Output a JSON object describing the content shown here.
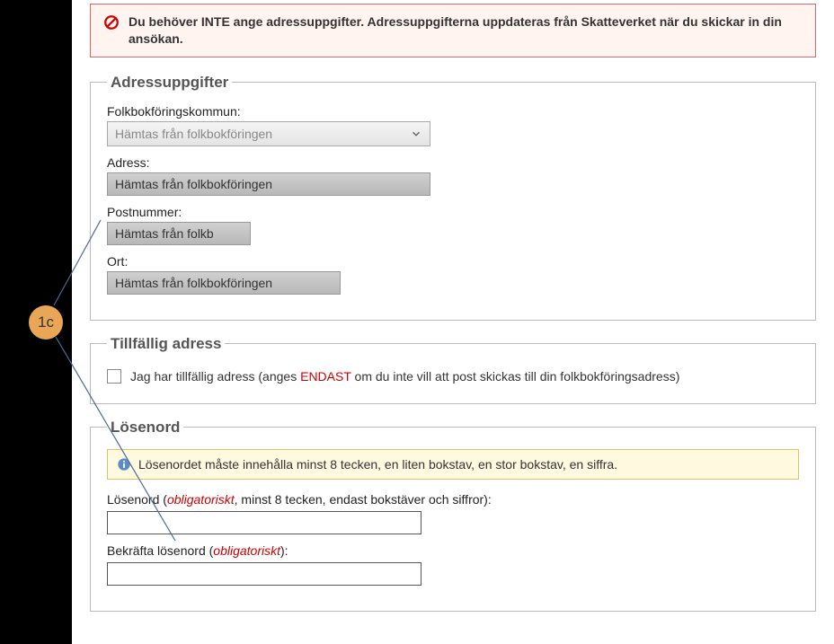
{
  "annotation": {
    "label": "1c"
  },
  "alert": {
    "text": "Du behöver INTE ange adressuppgifter. Adressuppgifterna uppdateras från Skatteverket när du skickar in din ansökan."
  },
  "address": {
    "legend": "Adressuppgifter",
    "kommun": {
      "label": "Folkbokföringskommun:",
      "value": "Hämtas från folkbokföringen"
    },
    "adress": {
      "label": "Adress:",
      "value": "Hämtas från folkbokföringen"
    },
    "postnummer": {
      "label": "Postnummer:",
      "value": "Hämtas från folkb"
    },
    "ort": {
      "label": "Ort:",
      "value": "Hämtas från folkbokföringen"
    }
  },
  "temp": {
    "legend": "Tillfällig adress",
    "check_pre": "Jag har tillfällig adress (anges ",
    "check_mid": "ENDAST",
    "check_post": " om du inte vill att post skickas till din folkbokföringsadress)"
  },
  "password": {
    "legend": "Lösenord",
    "info": "Lösenordet måste innehålla minst 8 tecken, en liten bokstav, en stor bokstav, en siffra.",
    "pw_pre": "Lösenord (",
    "pw_obl": "obligatoriskt",
    "pw_post": ", minst 8 tecken, endast bokstäver och siffror):",
    "conf_pre": "Bekräfta lösenord (",
    "conf_obl": "obligatoriskt",
    "conf_post": "):"
  }
}
